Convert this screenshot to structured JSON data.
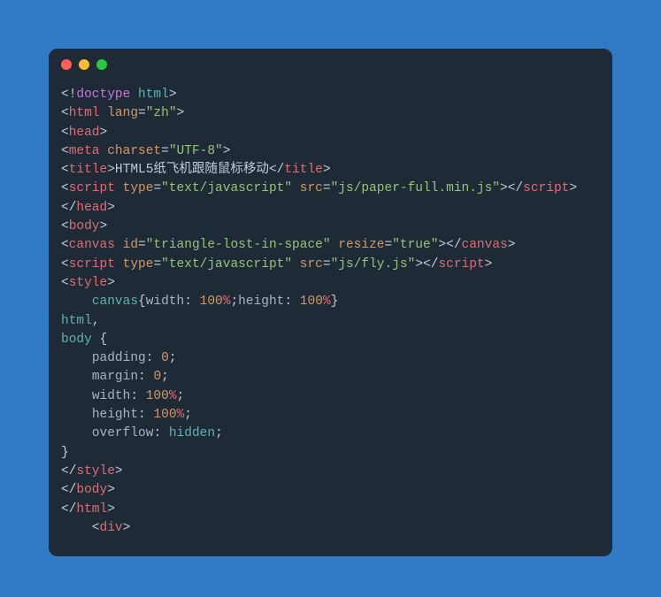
{
  "window": {
    "buttons": [
      "close",
      "minimize",
      "zoom"
    ]
  },
  "code": {
    "lines": [
      [
        {
          "t": "<!",
          "c": "p"
        },
        {
          "t": "doctype",
          "c": "kw"
        },
        {
          "t": " ",
          "c": "p"
        },
        {
          "t": "html",
          "c": "sl"
        },
        {
          "t": ">",
          "c": "p"
        }
      ],
      [
        {
          "t": "<",
          "c": "p"
        },
        {
          "t": "html",
          "c": "tg"
        },
        {
          "t": " ",
          "c": "p"
        },
        {
          "t": "lang",
          "c": "at"
        },
        {
          "t": "=",
          "c": "p"
        },
        {
          "t": "\"zh\"",
          "c": "st"
        },
        {
          "t": ">",
          "c": "p"
        }
      ],
      [
        {
          "t": "<",
          "c": "p"
        },
        {
          "t": "head",
          "c": "tg"
        },
        {
          "t": ">",
          "c": "p"
        }
      ],
      [
        {
          "t": "<",
          "c": "p"
        },
        {
          "t": "meta",
          "c": "tg"
        },
        {
          "t": " ",
          "c": "p"
        },
        {
          "t": "charset",
          "c": "at"
        },
        {
          "t": "=",
          "c": "p"
        },
        {
          "t": "\"UTF-8\"",
          "c": "st"
        },
        {
          "t": ">",
          "c": "p"
        }
      ],
      [
        {
          "t": "<",
          "c": "p"
        },
        {
          "t": "title",
          "c": "tg"
        },
        {
          "t": ">",
          "c": "p"
        },
        {
          "t": "HTML5纸飞机跟随鼠标移动",
          "c": "tx"
        },
        {
          "t": "</",
          "c": "p"
        },
        {
          "t": "title",
          "c": "tg"
        },
        {
          "t": ">",
          "c": "p"
        }
      ],
      [
        {
          "t": "<",
          "c": "p"
        },
        {
          "t": "script",
          "c": "tg"
        },
        {
          "t": " ",
          "c": "p"
        },
        {
          "t": "type",
          "c": "at"
        },
        {
          "t": "=",
          "c": "p"
        },
        {
          "t": "\"text/javascript\"",
          "c": "st"
        },
        {
          "t": " ",
          "c": "p"
        },
        {
          "t": "src",
          "c": "at"
        },
        {
          "t": "=",
          "c": "p"
        },
        {
          "t": "\"js/paper-full.min.js\"",
          "c": "st"
        },
        {
          "t": ">",
          "c": "p"
        },
        {
          "t": "</",
          "c": "p"
        },
        {
          "t": "script",
          "c": "tg"
        },
        {
          "t": ">",
          "c": "p"
        }
      ],
      [
        {
          "t": "</",
          "c": "p"
        },
        {
          "t": "head",
          "c": "tg"
        },
        {
          "t": ">",
          "c": "p"
        }
      ],
      [
        {
          "t": "<",
          "c": "p"
        },
        {
          "t": "body",
          "c": "tg"
        },
        {
          "t": ">",
          "c": "p"
        }
      ],
      [
        {
          "t": "<",
          "c": "p"
        },
        {
          "t": "canvas",
          "c": "tg"
        },
        {
          "t": " ",
          "c": "p"
        },
        {
          "t": "id",
          "c": "at"
        },
        {
          "t": "=",
          "c": "p"
        },
        {
          "t": "\"triangle-lost-in-space\"",
          "c": "st"
        },
        {
          "t": " ",
          "c": "p"
        },
        {
          "t": "resize",
          "c": "at"
        },
        {
          "t": "=",
          "c": "p"
        },
        {
          "t": "\"true\"",
          "c": "st"
        },
        {
          "t": ">",
          "c": "p"
        },
        {
          "t": "</",
          "c": "p"
        },
        {
          "t": "canvas",
          "c": "tg"
        },
        {
          "t": ">",
          "c": "p"
        }
      ],
      [
        {
          "t": "<",
          "c": "p"
        },
        {
          "t": "script",
          "c": "tg"
        },
        {
          "t": " ",
          "c": "p"
        },
        {
          "t": "type",
          "c": "at"
        },
        {
          "t": "=",
          "c": "p"
        },
        {
          "t": "\"text/javascript\"",
          "c": "st"
        },
        {
          "t": " ",
          "c": "p"
        },
        {
          "t": "src",
          "c": "at"
        },
        {
          "t": "=",
          "c": "p"
        },
        {
          "t": "\"js/fly.js\"",
          "c": "st"
        },
        {
          "t": ">",
          "c": "p"
        },
        {
          "t": "</",
          "c": "p"
        },
        {
          "t": "script",
          "c": "tg"
        },
        {
          "t": ">",
          "c": "p"
        }
      ],
      [
        {
          "t": "<",
          "c": "p"
        },
        {
          "t": "style",
          "c": "tg"
        },
        {
          "t": ">",
          "c": "p"
        }
      ],
      [
        {
          "t": "    ",
          "c": "p"
        },
        {
          "t": "canvas",
          "c": "sl"
        },
        {
          "t": "{",
          "c": "p"
        },
        {
          "t": "width",
          "c": "pr"
        },
        {
          "t": ": ",
          "c": "p"
        },
        {
          "t": "100",
          "c": "nu"
        },
        {
          "t": "%",
          "c": "un"
        },
        {
          "t": ";",
          "c": "p"
        },
        {
          "t": "height",
          "c": "pr"
        },
        {
          "t": ": ",
          "c": "p"
        },
        {
          "t": "100",
          "c": "nu"
        },
        {
          "t": "%",
          "c": "un"
        },
        {
          "t": "}",
          "c": "p"
        }
      ],
      [
        {
          "t": "html",
          "c": "sl"
        },
        {
          "t": ",",
          "c": "p"
        }
      ],
      [
        {
          "t": "body",
          "c": "sl"
        },
        {
          "t": " {",
          "c": "p"
        }
      ],
      [
        {
          "t": "    ",
          "c": "p"
        },
        {
          "t": "padding",
          "c": "pr"
        },
        {
          "t": ": ",
          "c": "p"
        },
        {
          "t": "0",
          "c": "nu"
        },
        {
          "t": ";",
          "c": "p"
        }
      ],
      [
        {
          "t": "    ",
          "c": "p"
        },
        {
          "t": "margin",
          "c": "pr"
        },
        {
          "t": ": ",
          "c": "p"
        },
        {
          "t": "0",
          "c": "nu"
        },
        {
          "t": ";",
          "c": "p"
        }
      ],
      [
        {
          "t": "    ",
          "c": "p"
        },
        {
          "t": "width",
          "c": "pr"
        },
        {
          "t": ": ",
          "c": "p"
        },
        {
          "t": "100",
          "c": "nu"
        },
        {
          "t": "%",
          "c": "un"
        },
        {
          "t": ";",
          "c": "p"
        }
      ],
      [
        {
          "t": "    ",
          "c": "p"
        },
        {
          "t": "height",
          "c": "pr"
        },
        {
          "t": ": ",
          "c": "p"
        },
        {
          "t": "100",
          "c": "nu"
        },
        {
          "t": "%",
          "c": "un"
        },
        {
          "t": ";",
          "c": "p"
        }
      ],
      [
        {
          "t": "    ",
          "c": "p"
        },
        {
          "t": "overflow",
          "c": "pr"
        },
        {
          "t": ": ",
          "c": "p"
        },
        {
          "t": "hidden",
          "c": "sl"
        },
        {
          "t": ";",
          "c": "p"
        }
      ],
      [
        {
          "t": "}",
          "c": "p"
        }
      ],
      [
        {
          "t": "</",
          "c": "p"
        },
        {
          "t": "style",
          "c": "tg"
        },
        {
          "t": ">",
          "c": "p"
        }
      ],
      [
        {
          "t": "</",
          "c": "p"
        },
        {
          "t": "body",
          "c": "tg"
        },
        {
          "t": ">",
          "c": "p"
        }
      ],
      [
        {
          "t": "</",
          "c": "p"
        },
        {
          "t": "html",
          "c": "tg"
        },
        {
          "t": ">",
          "c": "p"
        }
      ],
      [
        {
          "t": "    <",
          "c": "p"
        },
        {
          "t": "div",
          "c": "tg"
        },
        {
          "t": ">",
          "c": "p"
        }
      ]
    ]
  }
}
